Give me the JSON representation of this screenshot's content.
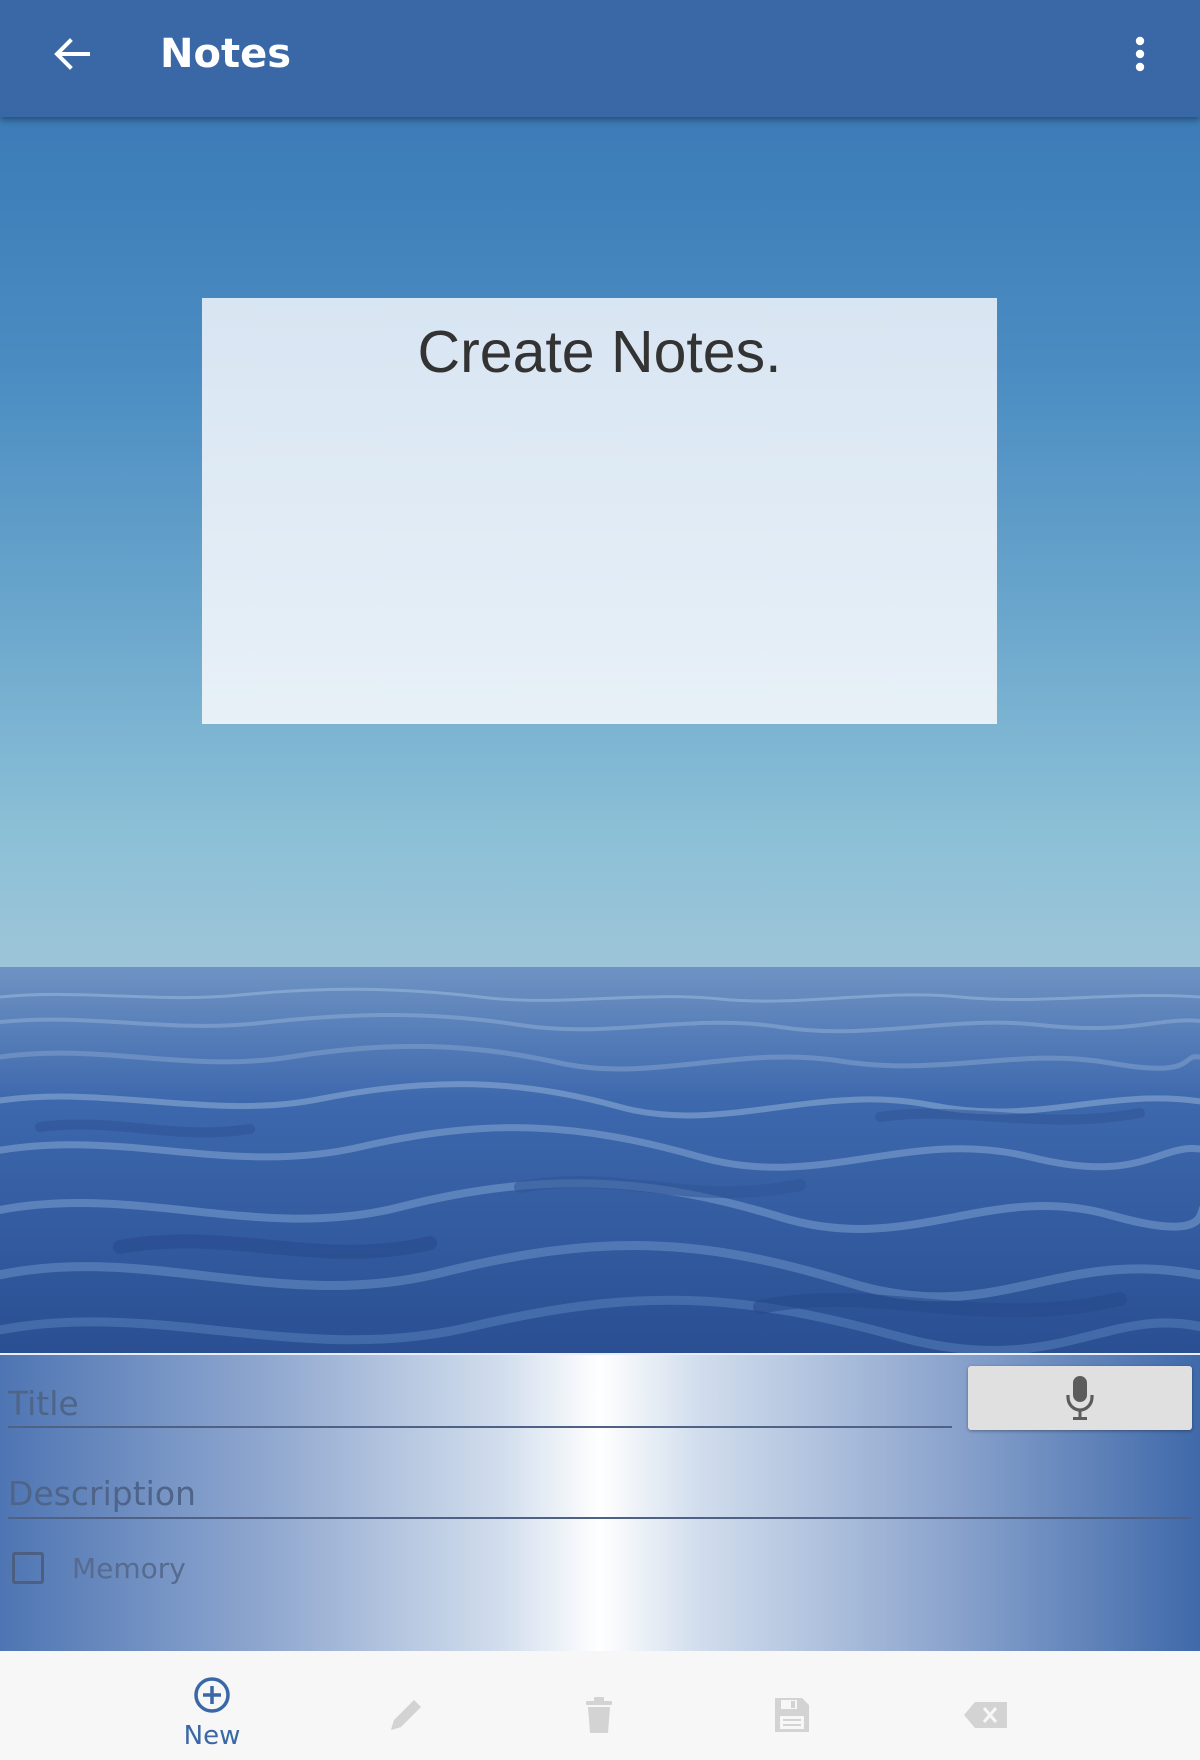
{
  "appbar": {
    "title": "Notes",
    "back_icon": "arrow-left-icon",
    "menu_icon": "more-vertical-icon",
    "color": "#3a67a6"
  },
  "card": {
    "title": "Create Notes."
  },
  "form": {
    "title_placeholder": "Title",
    "description_placeholder": "Description",
    "mic_icon": "microphone-icon",
    "checkbox_label": "Memory",
    "checkbox_checked": false
  },
  "bottom_nav": {
    "items": [
      {
        "icon": "add-circle-icon",
        "label": "New",
        "active": true
      },
      {
        "icon": "pencil-icon",
        "label": "",
        "active": false
      },
      {
        "icon": "trash-icon",
        "label": "",
        "active": false
      },
      {
        "icon": "save-icon",
        "label": "",
        "active": false
      },
      {
        "icon": "backspace-icon",
        "label": "",
        "active": false
      }
    ],
    "active_color": "#3a67a6",
    "inactive_color": "#d3d3d3"
  }
}
